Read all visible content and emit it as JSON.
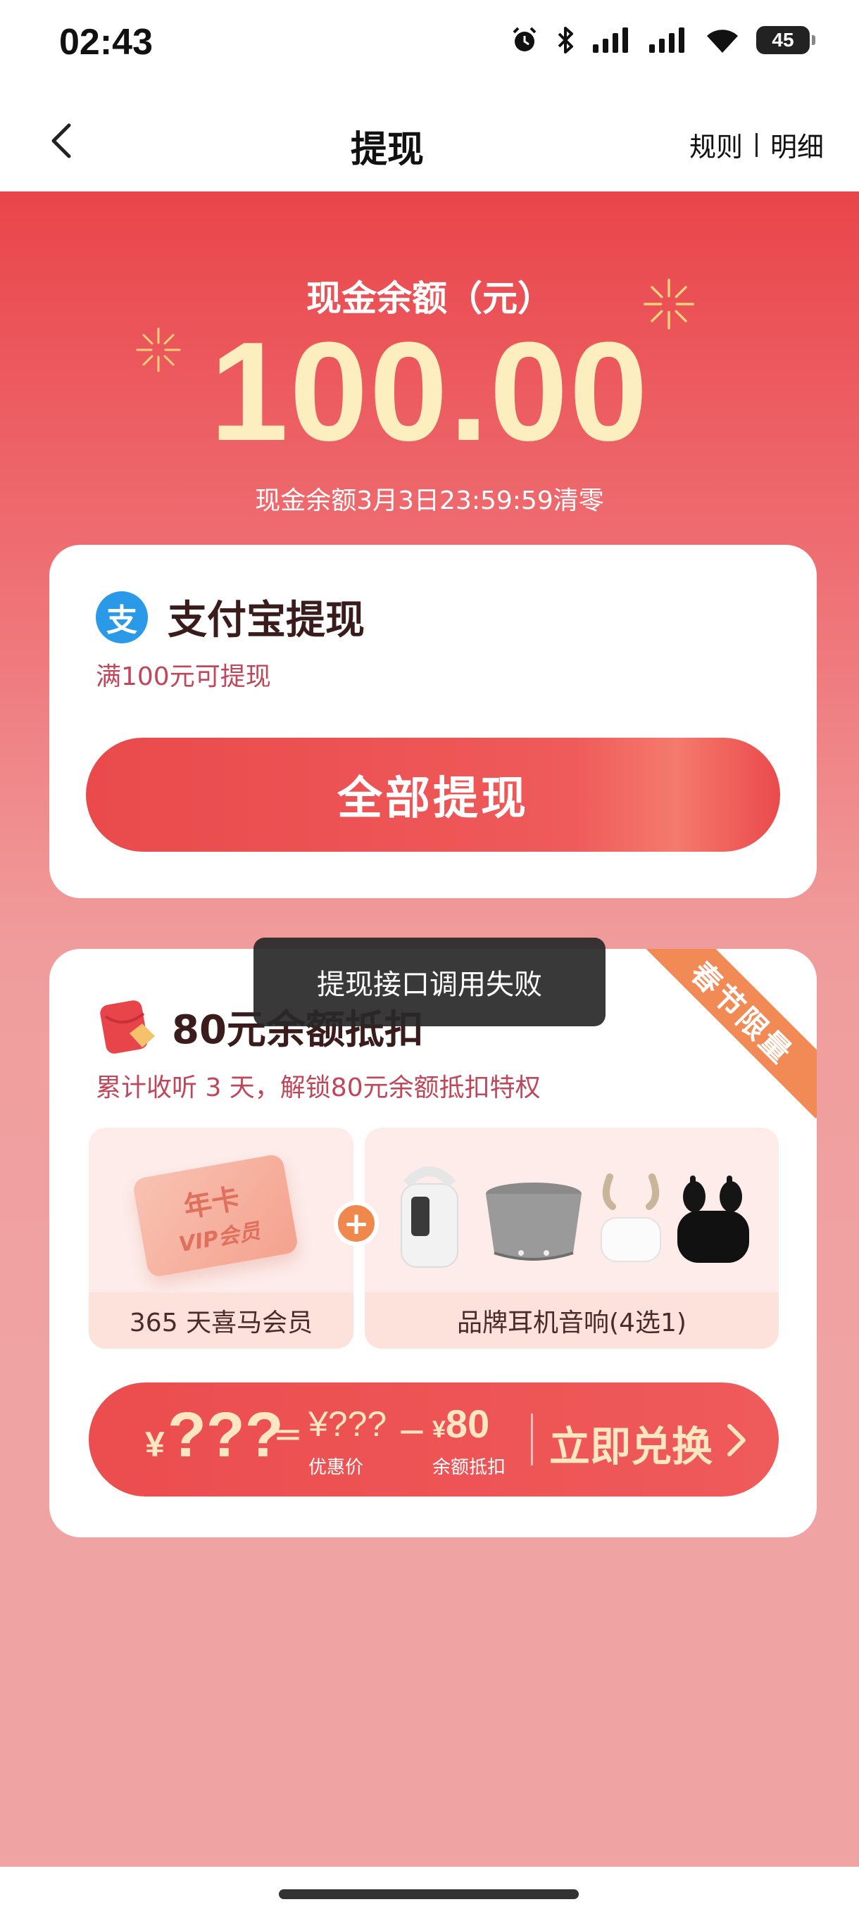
{
  "status_bar": {
    "time": "02:43",
    "battery": "45"
  },
  "nav": {
    "title": "提现",
    "rules": "规则",
    "details": "明细"
  },
  "balance": {
    "label": "现金余额（元）",
    "amount": "100.00",
    "expire_note": "现金余额3月3日23:59:59清零"
  },
  "alipay": {
    "title": "支付宝提现",
    "logo_glyph": "支",
    "subtitle": "满100元可提现",
    "button": "全部提现"
  },
  "promo": {
    "ribbon": "春节限量",
    "title": "80元余额抵扣",
    "subtitle": "累计收听 3 天，解锁80元余额抵扣特权",
    "vip_card_line1": "年卡",
    "vip_card_line2": "VIP会员",
    "left_label": "365 天喜马会员",
    "right_label": "品牌耳机音响(4选1)",
    "plus": "+",
    "price_currency": "¥",
    "price_value": "???",
    "equals": "=",
    "orig_value": "¥???",
    "orig_caption": "优惠价",
    "minus": "−",
    "deduct_currency": "¥",
    "deduct_value": "80",
    "deduct_caption": "余额抵扣",
    "cta": "立即兑换"
  },
  "toast": "提现接口调用失败",
  "colors": {
    "brand_red": "#e9454a",
    "gold": "#fdeec0",
    "ribbon_orange": "#f28a55",
    "alipay_blue": "#2a9ae8"
  }
}
